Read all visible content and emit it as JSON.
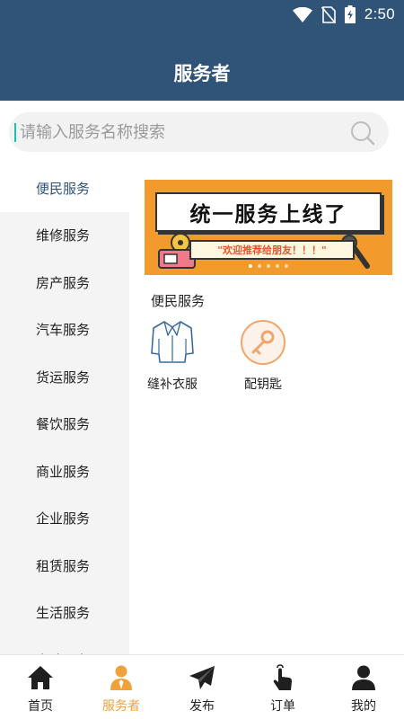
{
  "status_bar": {
    "time": "2:50"
  },
  "header": {
    "title": "服务者"
  },
  "search": {
    "placeholder": "请输入服务名称搜索"
  },
  "categories": [
    {
      "label": "便民服务",
      "active": true
    },
    {
      "label": "维修服务"
    },
    {
      "label": "房产服务"
    },
    {
      "label": "汽车服务"
    },
    {
      "label": "货运服务"
    },
    {
      "label": "餐饮服务"
    },
    {
      "label": "商业服务"
    },
    {
      "label": "企业服务"
    },
    {
      "label": "租赁服务"
    },
    {
      "label": "生活服务"
    },
    {
      "label": "家政服务"
    }
  ],
  "banner": {
    "title": "统一服务上线了",
    "subtitle": "\"欢迎推荐给朋友！！！\"",
    "slide_count": 5,
    "active_slide": 1
  },
  "section": {
    "title": "便民服务",
    "items": [
      {
        "label": "缝补衣服",
        "icon": "shirt-icon"
      },
      {
        "label": "配钥匙",
        "icon": "key-icon"
      }
    ]
  },
  "bottom_nav": [
    {
      "label": "首页",
      "icon": "home-icon"
    },
    {
      "label": "服务者",
      "icon": "service-person-icon",
      "active": true
    },
    {
      "label": "发布",
      "icon": "paper-plane-icon"
    },
    {
      "label": "订单",
      "icon": "tap-hand-icon"
    },
    {
      "label": "我的",
      "icon": "user-icon"
    }
  ],
  "colors": {
    "header_bg": "#2f5478",
    "accent": "#f0a23a",
    "banner_bg": "#f39a2c",
    "cursor": "#1fbfa7"
  }
}
